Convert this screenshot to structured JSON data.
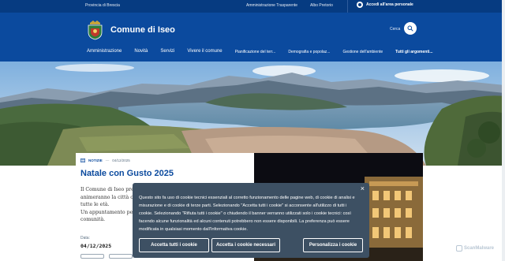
{
  "topbar": {
    "region": "Provincia di Brescia",
    "links": [
      "Amministrazione Trasparente",
      "Albo Pretorio"
    ],
    "login_label": "Accedi all'area personale"
  },
  "header": {
    "site_title": "Comune di Iseo",
    "search_label": "Cerca",
    "nav": [
      "Amministrazione",
      "Novità",
      "Servizi",
      "Vivere il comune",
      "Pianificazione del terr...",
      "Demografia e popolaz...",
      "Gestione dell'ambiente",
      "Tutti gli argomenti..."
    ]
  },
  "news": {
    "tag": "NOTIZIE",
    "dash": "—",
    "date_meta": "04/12/2025",
    "title": "Natale con Gusto 2025",
    "lines": [
      "Il Comune di Iseo prese",
      "animeranno la città con",
      "tutte le età.",
      "Un appuntamento pens",
      "comunità."
    ],
    "date_label": "Data:",
    "date_value": "04/12/2025"
  },
  "cookie": {
    "close": "×",
    "lines": [
      "Questo sito fa uso di cookie tecnici essenziali al corretto funzionamento delle pagine web, di cookie di analisi e",
      "misurazione e di cookie di terze parti. Selezionando \"Accetta tutti i cookie\" si acconsente all'utilizzo di tutti i",
      "cookie. Selezionando \"Rifiuta tutti i cookie\" o chiudendo il banner verranno utilizzati solo i cookie tecnici: così",
      "facendo alcune funzionalità ed alcuni contenuti potrebbero non essere disponibili. La preferenza può essere",
      "modificata in qualsiasi momento dall'Informativa cookie."
    ],
    "btn_accept": "Accetta tutti i cookie",
    "btn_necessary": "Accetta i cookie necessari",
    "btn_customize": "Personalizza i cookie"
  },
  "watermark": "ScanMalware",
  "colors": {
    "topbar": "#063b81",
    "header": "#0b4a9e",
    "cookie_bg": "#3d5063",
    "title_blue": "#0b4a9e"
  }
}
